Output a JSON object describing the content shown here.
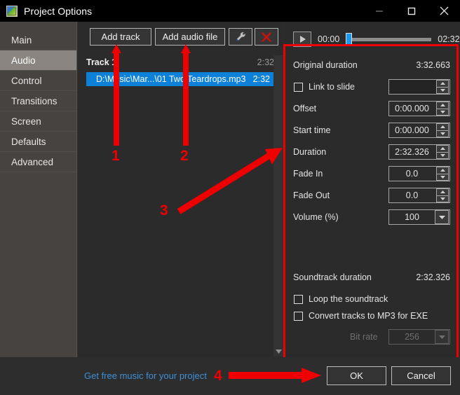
{
  "window": {
    "title": "Project Options",
    "icon": "app-picture-icon",
    "minimize": "minimize-icon",
    "maximize": "maximize-icon",
    "close": "close-icon"
  },
  "sidebar": {
    "items": [
      {
        "label": "Main",
        "active": false
      },
      {
        "label": "Audio",
        "active": true
      },
      {
        "label": "Control",
        "active": false
      },
      {
        "label": "Transitions",
        "active": false
      },
      {
        "label": "Screen",
        "active": false
      },
      {
        "label": "Defaults",
        "active": false
      },
      {
        "label": "Advanced",
        "active": false
      }
    ]
  },
  "toolbar": {
    "add_track": "Add track",
    "add_audio_file": "Add audio file",
    "tool_icon": "wrench-icon",
    "delete_icon": "red-x-icon"
  },
  "track_list": {
    "header_name": "Track 1",
    "header_duration": "2:32",
    "rows": [
      {
        "name": "D:\\Music\\Mar...\\01 Two Teardrops.mp3",
        "duration": "2:32"
      }
    ],
    "scroll_down_icon": "chevron-down-icon"
  },
  "player": {
    "play_icon": "play-icon",
    "current_time": "00:00",
    "total_time": "02:32",
    "progress_percent": 0
  },
  "properties": {
    "original_duration_label": "Original duration",
    "original_duration_value": "3:32.663",
    "link_to_slide_label": "Link to slide",
    "link_to_slide_value": "",
    "offset_label": "Offset",
    "offset_value": "0:00.000",
    "start_time_label": "Start time",
    "start_time_value": "0:00.000",
    "duration_label": "Duration",
    "duration_value": "2:32.326",
    "fade_in_label": "Fade In",
    "fade_in_value": "0.0",
    "fade_out_label": "Fade Out",
    "fade_out_value": "0.0",
    "volume_label": "Volume (%)",
    "volume_value": "100",
    "soundtrack_duration_label": "Soundtrack duration",
    "soundtrack_duration_value": "2:32.326",
    "loop_soundtrack_label": "Loop the soundtrack",
    "convert_tracks_label": "Convert tracks to MP3 for EXE",
    "bit_rate_label": "Bit rate",
    "bit_rate_value": "256"
  },
  "footer": {
    "free_music_link": "Get free music for your project",
    "ok": "OK",
    "cancel": "Cancel"
  },
  "annotations": {
    "items": [
      {
        "number": "1"
      },
      {
        "number": "2"
      },
      {
        "number": "3"
      },
      {
        "number": "4"
      }
    ],
    "color": "#ee0000"
  },
  "colors": {
    "accent_selection": "#0d80d8",
    "annotation_red": "#ee0000",
    "link_blue": "#3f8fd4",
    "sidebar_bg": "#474340",
    "panel_bg": "#2b2b2b"
  }
}
